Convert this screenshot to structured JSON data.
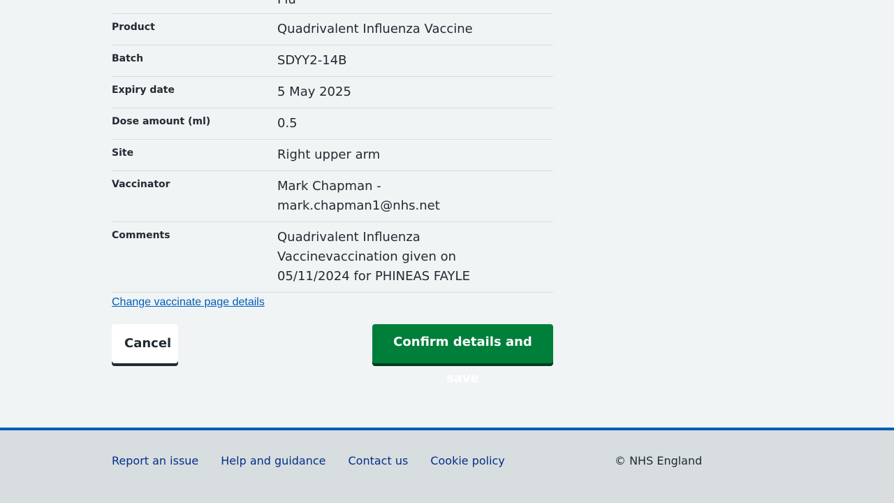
{
  "summary": {
    "partial_row": {
      "value": "Flu"
    },
    "rows": [
      {
        "key": "Product",
        "value": "Quadrivalent Influenza Vaccine"
      },
      {
        "key": "Batch",
        "value": "SDYY2-14B"
      },
      {
        "key": "Expiry date",
        "value": "5 May 2025"
      },
      {
        "key": "Dose amount (ml)",
        "value": "0.5"
      },
      {
        "key": "Site",
        "value": "Right upper arm"
      },
      {
        "key": "Vaccinator",
        "value": "Mark Chapman - mark.chapman1@nhs.net"
      },
      {
        "key": "Comments",
        "value": "Quadrivalent Influenza Vaccinevaccination given on 05/11/2024 for PHINEAS FAYLE"
      }
    ]
  },
  "actions": {
    "change_link": "Change vaccinate page details",
    "cancel_label": "Cancel",
    "confirm_label": "Confirm details and save"
  },
  "footer": {
    "links": [
      "Report an issue",
      "Help and guidance",
      "Contact us",
      "Cookie policy"
    ],
    "copyright": "© NHS England"
  },
  "colors": {
    "background": "#f0f4f5",
    "link": "#005eb8",
    "primary_button": "#007f3b",
    "footer_border": "#005eb8",
    "footer_background": "#d8dde0"
  }
}
